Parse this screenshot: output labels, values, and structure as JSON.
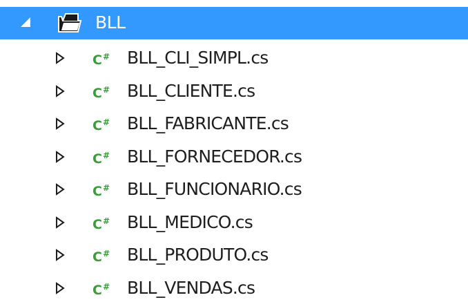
{
  "tree": {
    "folder": {
      "label": "BLL",
      "expanded": true,
      "icon": "folder-open-icon"
    },
    "files": [
      {
        "label": "BLL_CLI_SIMPL.cs",
        "icon": "csharp-file-icon",
        "badge": "C#"
      },
      {
        "label": "BLL_CLIENTE.cs",
        "icon": "csharp-file-icon",
        "badge": "C#"
      },
      {
        "label": "BLL_FABRICANTE.cs",
        "icon": "csharp-file-icon",
        "badge": "C#"
      },
      {
        "label": "BLL_FORNECEDOR.cs",
        "icon": "csharp-file-icon",
        "badge": "C#"
      },
      {
        "label": "BLL_FUNCIONARIO.cs",
        "icon": "csharp-file-icon",
        "badge": "C#"
      },
      {
        "label": "BLL_MEDICO.cs",
        "icon": "csharp-file-icon",
        "badge": "C#"
      },
      {
        "label": "BLL_PRODUTO.cs",
        "icon": "csharp-file-icon",
        "badge": "C#"
      },
      {
        "label": "BLL_VENDAS.cs",
        "icon": "csharp-file-icon",
        "badge": "C#"
      }
    ]
  },
  "colors": {
    "selection": "#3399ff",
    "csharp_icon": "#399e3a",
    "text": "#1e1e1e"
  }
}
